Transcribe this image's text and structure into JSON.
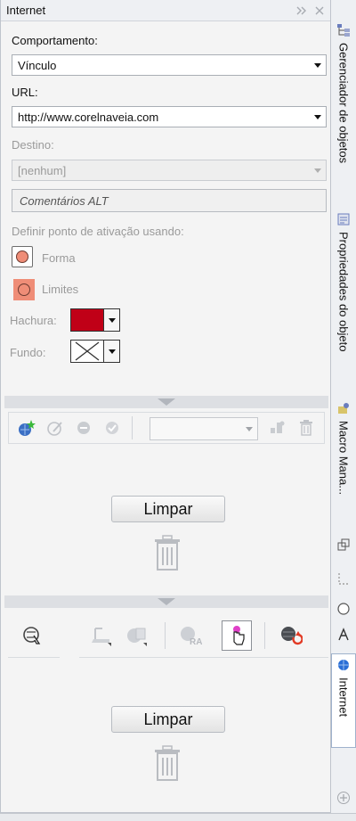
{
  "docker": {
    "title": "Internet"
  },
  "form": {
    "behavior_label": "Comportamento:",
    "behavior_value": "Vínculo",
    "url_label": "URL:",
    "url_value": "http://www.corelnaveia.com",
    "target_label": "Destino:",
    "target_value": "[nenhum]",
    "alt_text": "Comentários ALT",
    "hotspot_label": "Definir ponto de ativação usando:",
    "shape_option": "Forma",
    "bounds_option": "Limites",
    "hatch_label": "Hachura:",
    "hatch_color": "#c00017",
    "background_label": "Fundo:"
  },
  "upper_panel": {
    "clear_label": "Limpar",
    "icons": [
      "new-link-icon",
      "edit-link-icon",
      "delete-link-icon",
      "check-link-icon",
      "bookmark-combo",
      "add-bookmark-icon",
      "trash-icon"
    ]
  },
  "lower_panel": {
    "clear_label": "Limpar",
    "icons": [
      "inspect-icon",
      "web-text-icon",
      "web-objects-icon",
      "web-image-icon",
      "hotspot-icon",
      "web-refresh-icon"
    ]
  },
  "right_tabs": [
    {
      "label": "Gerenciador de objetos",
      "icon": "object-manager-icon"
    },
    {
      "label": "Propriedades do objeto",
      "icon": "object-properties-icon"
    },
    {
      "label": "Macro Mana...",
      "icon": "macro-icon"
    },
    {
      "label": "Internet",
      "icon": "globe-icon",
      "active": true
    }
  ],
  "colors": {
    "accent": "#2a6ed6",
    "shape_fill": "#ef8d77"
  }
}
